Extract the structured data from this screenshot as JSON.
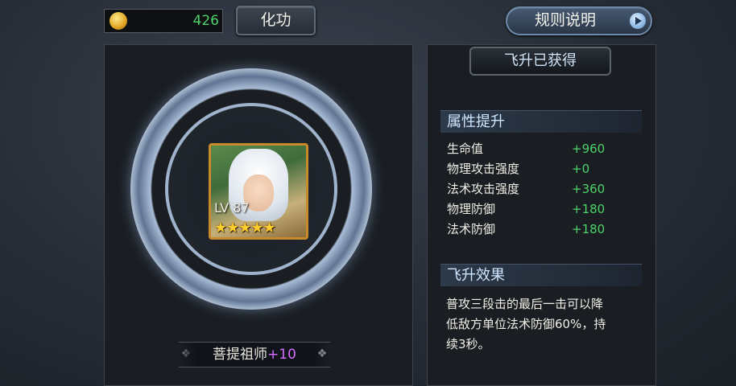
{
  "top_bar": {
    "gold_icon": "gold-coin-icon",
    "gold_value": "426",
    "huagong_label": "化功",
    "rules_label": "规则说明",
    "rules_icon": "play-arrow-icon"
  },
  "hero": {
    "level": "LV 87",
    "stars": "★★★★★",
    "star_count": 5,
    "name": "菩提祖师",
    "name_plus": "+10"
  },
  "right": {
    "banner": "飞升已获得",
    "attr_title": "属性提升",
    "stats": [
      {
        "name": "生命值",
        "value": "+960"
      },
      {
        "name": "物理攻击强度",
        "value": "+0"
      },
      {
        "name": "法术攻击强度",
        "value": "+360"
      },
      {
        "name": "物理防御",
        "value": "+180"
      },
      {
        "name": "法术防御",
        "value": "+180"
      }
    ],
    "effect_title": "飞升效果",
    "effect_lines": [
      "普攻三段击的最后一击可以降",
      "低敌方单位法术防御60%，持",
      "续3秒。"
    ]
  },
  "colors": {
    "stat_value": "#4ed26a",
    "plus": "#d36dff",
    "frame_gold": "#c88a2a"
  }
}
